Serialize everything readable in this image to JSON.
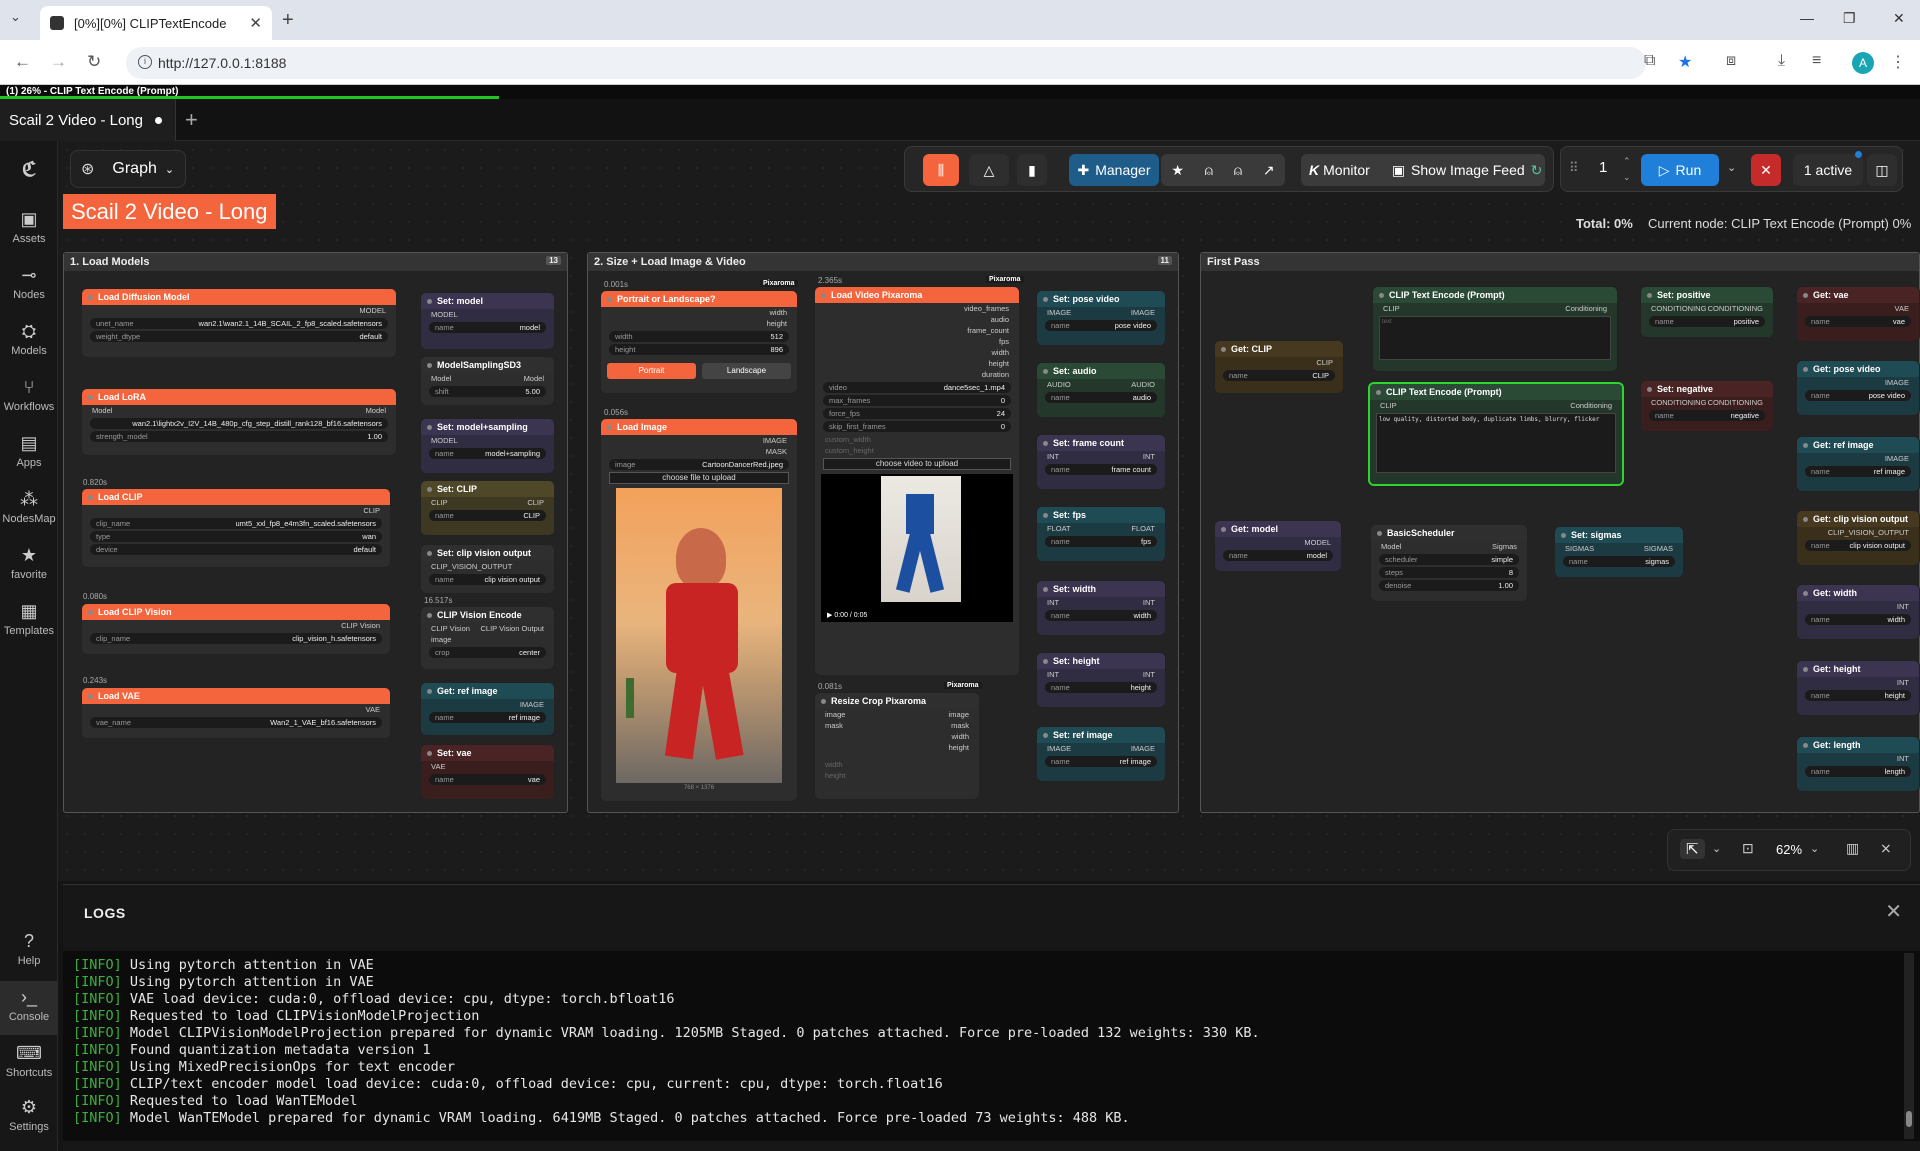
{
  "browser": {
    "tab_title": "[0%][0%] CLIPTextEncode",
    "url": "http://127.0.0.1:8188",
    "avatar_letter": "A"
  },
  "progress": {
    "text": "(1) 26% - CLIP Text Encode (Prompt)",
    "fraction": 0.26
  },
  "workflow_tab": {
    "title": "Scail 2 Video - Long"
  },
  "sidebar": {
    "items": [
      {
        "label": "Assets",
        "icon": "image-icon"
      },
      {
        "label": "Nodes",
        "icon": "nodes-icon"
      },
      {
        "label": "Models",
        "icon": "models-icon"
      },
      {
        "label": "Workflows",
        "icon": "workflows-icon"
      },
      {
        "label": "Apps",
        "icon": "apps-icon"
      },
      {
        "label": "NodesMap",
        "icon": "nodesmap-icon"
      },
      {
        "label": "favorite",
        "icon": "star-icon"
      },
      {
        "label": "Templates",
        "icon": "templates-icon"
      }
    ],
    "bottom": [
      {
        "label": "Help",
        "icon": "help-icon"
      },
      {
        "label": "Console",
        "icon": "console-icon"
      },
      {
        "label": "Shortcuts",
        "icon": "keyboard-icon"
      },
      {
        "label": "Settings",
        "icon": "gear-icon"
      }
    ]
  },
  "toolbar": {
    "graph_label": "Graph",
    "manager_label": "Manager",
    "monitor_label": "Monitor",
    "monitor_prefix": "K",
    "show_feed_label": "Show Image Feed",
    "queue_count": "1",
    "run_label": "Run",
    "active_label": "1 active"
  },
  "title_banner": "Scail 2 Video - Long",
  "status": {
    "total_label": "Total: 0%",
    "current_node": "Current node: CLIP Text Encode (Prompt) 0%"
  },
  "groups": {
    "load_models": {
      "title": "1. Load Models",
      "count": "13"
    },
    "size_load": {
      "title": "2. Size + Load Image & Video",
      "count": "11"
    },
    "first_pass": {
      "title": "First Pass"
    }
  },
  "nodes": {
    "load_diffusion": {
      "title": "Load Diffusion Model",
      "out": "MODEL",
      "unet_k": "unet_name",
      "unet_v": "wan2.1\\wan2.1_14B_SCAIL_2_fp8_scaled.safetensors",
      "dtype_k": "weight_dtype",
      "dtype_v": "default"
    },
    "set_model": {
      "title": "Set: model",
      "port": "MODEL",
      "name_k": "name",
      "name_v": "model"
    },
    "model_sampling": {
      "title": "ModelSamplingSD3",
      "in": "Model",
      "out": "Model",
      "shift_k": "shift",
      "shift_v": "5.00"
    },
    "load_lora": {
      "title": "Load LoRA",
      "in": "Model",
      "out": "Model",
      "lora_v": "wan2.1\\lightx2v_I2V_14B_480p_cfg_step_distill_rank128_bf16.safetensors",
      "str_k": "strength_model",
      "str_v": "1.00"
    },
    "set_model_sampling": {
      "title": "Set: model+sampling",
      "port": "MODEL",
      "name_k": "name",
      "name_v": "model+sampling"
    },
    "load_clip": {
      "timing": "0.820s",
      "title": "Load CLIP",
      "out": "CLIP",
      "clip_k": "clip_name",
      "clip_v": "umt5_xxl_fp8_e4m3fn_scaled.safetensors",
      "type_k": "type",
      "type_v": "wan",
      "device_k": "device",
      "device_v": "default"
    },
    "set_clip": {
      "title": "Set: CLIP",
      "in": "CLIP",
      "out": "CLIP",
      "name_k": "name",
      "name_v": "CLIP"
    },
    "set_clip_vision": {
      "title": "Set: clip vision output",
      "port": "CLIP_VISION_OUTPUT",
      "name_k": "name",
      "name_v": "clip vision output"
    },
    "load_clip_vision": {
      "timing": "0.080s",
      "title": "Load CLIP Vision",
      "out": "CLIP Vision",
      "k": "clip_name",
      "v": "clip_vision_h.safetensors"
    },
    "clip_vision_encode": {
      "timing": "16.517s",
      "title": "CLIP Vision Encode",
      "in1": "CLIP Vision",
      "out": "CLIP Vision Output",
      "in2": "image",
      "crop_k": "crop",
      "crop_v": "center"
    },
    "load_vae": {
      "timing": "0.243s",
      "title": "Load VAE",
      "out": "VAE",
      "k": "vae_name",
      "v": "Wan2_1_VAE_bf16.safetensors"
    },
    "get_ref_image": {
      "title": "Get: ref image",
      "out": "IMAGE",
      "name_k": "name",
      "name_v": "ref image"
    },
    "set_vae": {
      "title": "Set: vae",
      "port": "VAE",
      "name_k": "name",
      "name_v": "vae"
    },
    "portrait": {
      "timing": "0.001s",
      "title": "Portrait or Landscape?",
      "badge": "Pixaroma",
      "out1": "width",
      "out2": "height",
      "w_k": "width",
      "w_v": "512",
      "h_k": "height",
      "h_v": "896",
      "btn1": "Portrait",
      "btn2": "Landscape"
    },
    "load_image": {
      "timing": "0.056s",
      "title": "Load Image",
      "out1": "IMAGE",
      "out2": "MASK",
      "k": "image",
      "v": "CartoonDancerRed.jpeg",
      "upload": "choose file to upload",
      "dims": "768 × 1376"
    },
    "load_video": {
      "timing": "2.365s",
      "title": "Load Video Pixaroma",
      "badge": "Pixaroma",
      "outs": [
        "video_frames",
        "audio",
        "frame_count",
        "fps",
        "width",
        "height",
        "duration"
      ],
      "video_v": "dance5sec_1.mp4",
      "max_frames_v": "0",
      "force_fps_v": "24",
      "skip_v": "0",
      "custom_width": "custom_width",
      "custom_height": "custom_height",
      "upload": "choose video to upload",
      "time": "0:00 / 0:05"
    },
    "resize_crop": {
      "timing": "0.081s",
      "title": "Resize Crop Pixaroma",
      "badge": "Pixaroma",
      "in1": "image",
      "in2": "mask",
      "outs": [
        "image",
        "mask",
        "width",
        "height"
      ],
      "w": "width",
      "h": "height"
    },
    "set_pose_video": {
      "title": "Set: pose video",
      "port": "IMAGE",
      "name_v": "pose video"
    },
    "set_audio": {
      "title": "Set: audio",
      "port": "AUDIO",
      "name_v": "audio"
    },
    "set_frame_count": {
      "title": "Set: frame count",
      "port": "INT",
      "name_v": "frame count"
    },
    "set_fps": {
      "title": "Set: fps",
      "port": "FLOAT",
      "name_v": "fps"
    },
    "set_width": {
      "title": "Set: width",
      "port": "INT",
      "name_v": "width"
    },
    "set_height": {
      "title": "Set: height",
      "port": "INT",
      "name_v": "height"
    },
    "set_ref_image": {
      "title": "Set: ref image",
      "port": "IMAGE",
      "name_v": "ref image"
    },
    "get_clip": {
      "title": "Get: CLIP",
      "out": "CLIP",
      "name_v": "CLIP"
    },
    "clip_pos": {
      "title": "CLIP Text Encode (Prompt)",
      "in": "CLIP",
      "out": "Conditioning",
      "text_ph": "text"
    },
    "clip_neg": {
      "title": "CLIP Text Encode (Prompt)",
      "in": "CLIP",
      "out": "Conditioning",
      "text": "low quality, distorted body, duplicate limbs, blurry, flicker"
    },
    "set_positive": {
      "title": "Set: positive",
      "port": "CONDITIONING",
      "name_v": "positive"
    },
    "set_negative": {
      "title": "Set: negative",
      "port": "CONDITIONING",
      "name_v": "negative"
    },
    "get_vae": {
      "title": "Get: vae",
      "out": "VAE",
      "name_v": "vae"
    },
    "get_pose_video": {
      "title": "Get: pose video",
      "out": "IMAGE",
      "name_v": "pose video"
    },
    "get_ref_image2": {
      "title": "Get: ref image",
      "out": "IMAGE",
      "name_v": "ref image"
    },
    "get_model": {
      "title": "Get: model",
      "out": "MODEL",
      "name_v": "model"
    },
    "basic_scheduler": {
      "title": "BasicScheduler",
      "in": "Model",
      "out": "Sigmas",
      "sched_k": "scheduler",
      "sched_v": "simple",
      "steps_k": "steps",
      "steps_v": "8",
      "den_k": "denoise",
      "den_v": "1.00"
    },
    "set_sigmas": {
      "title": "Set: sigmas",
      "port": "SIGMAS",
      "name_v": "sigmas"
    },
    "get_clip_vision": {
      "title": "Get: clip vision output",
      "out": "CLIP_VISION_OUTPUT",
      "name_v": "clip vision output"
    },
    "get_width": {
      "title": "Get: width",
      "out": "INT",
      "name_v": "width"
    },
    "get_height": {
      "title": "Get: height",
      "out": "INT",
      "name_v": "height"
    },
    "get_length": {
      "title": "Get: length",
      "out": "INT",
      "name_v": "length"
    }
  },
  "zoom": {
    "level": "62%"
  },
  "logs": {
    "title": "LOGS",
    "tag": "[INFO]",
    "lines": [
      "Using pytorch attention in VAE",
      "Using pytorch attention in VAE",
      "VAE load device: cuda:0, offload device: cpu, dtype: torch.bfloat16",
      "Requested to load CLIPVisionModelProjection",
      "Model CLIPVisionModelProjection prepared for dynamic VRAM loading. 1205MB Staged. 0 patches attached. Force pre-loaded 132 weights: 330 KB.",
      "Found quantization metadata version 1",
      "Using MixedPrecisionOps for text encoder",
      "CLIP/text encoder model load device: cuda:0, offload device: cpu, current: cpu, dtype: torch.float16",
      "Requested to load WanTEModel",
      "Model WanTEModel prepared for dynamic VRAM loading. 6419MB Staged. 0 patches attached. Force pre-loaded 73 weights: 488 KB."
    ]
  }
}
